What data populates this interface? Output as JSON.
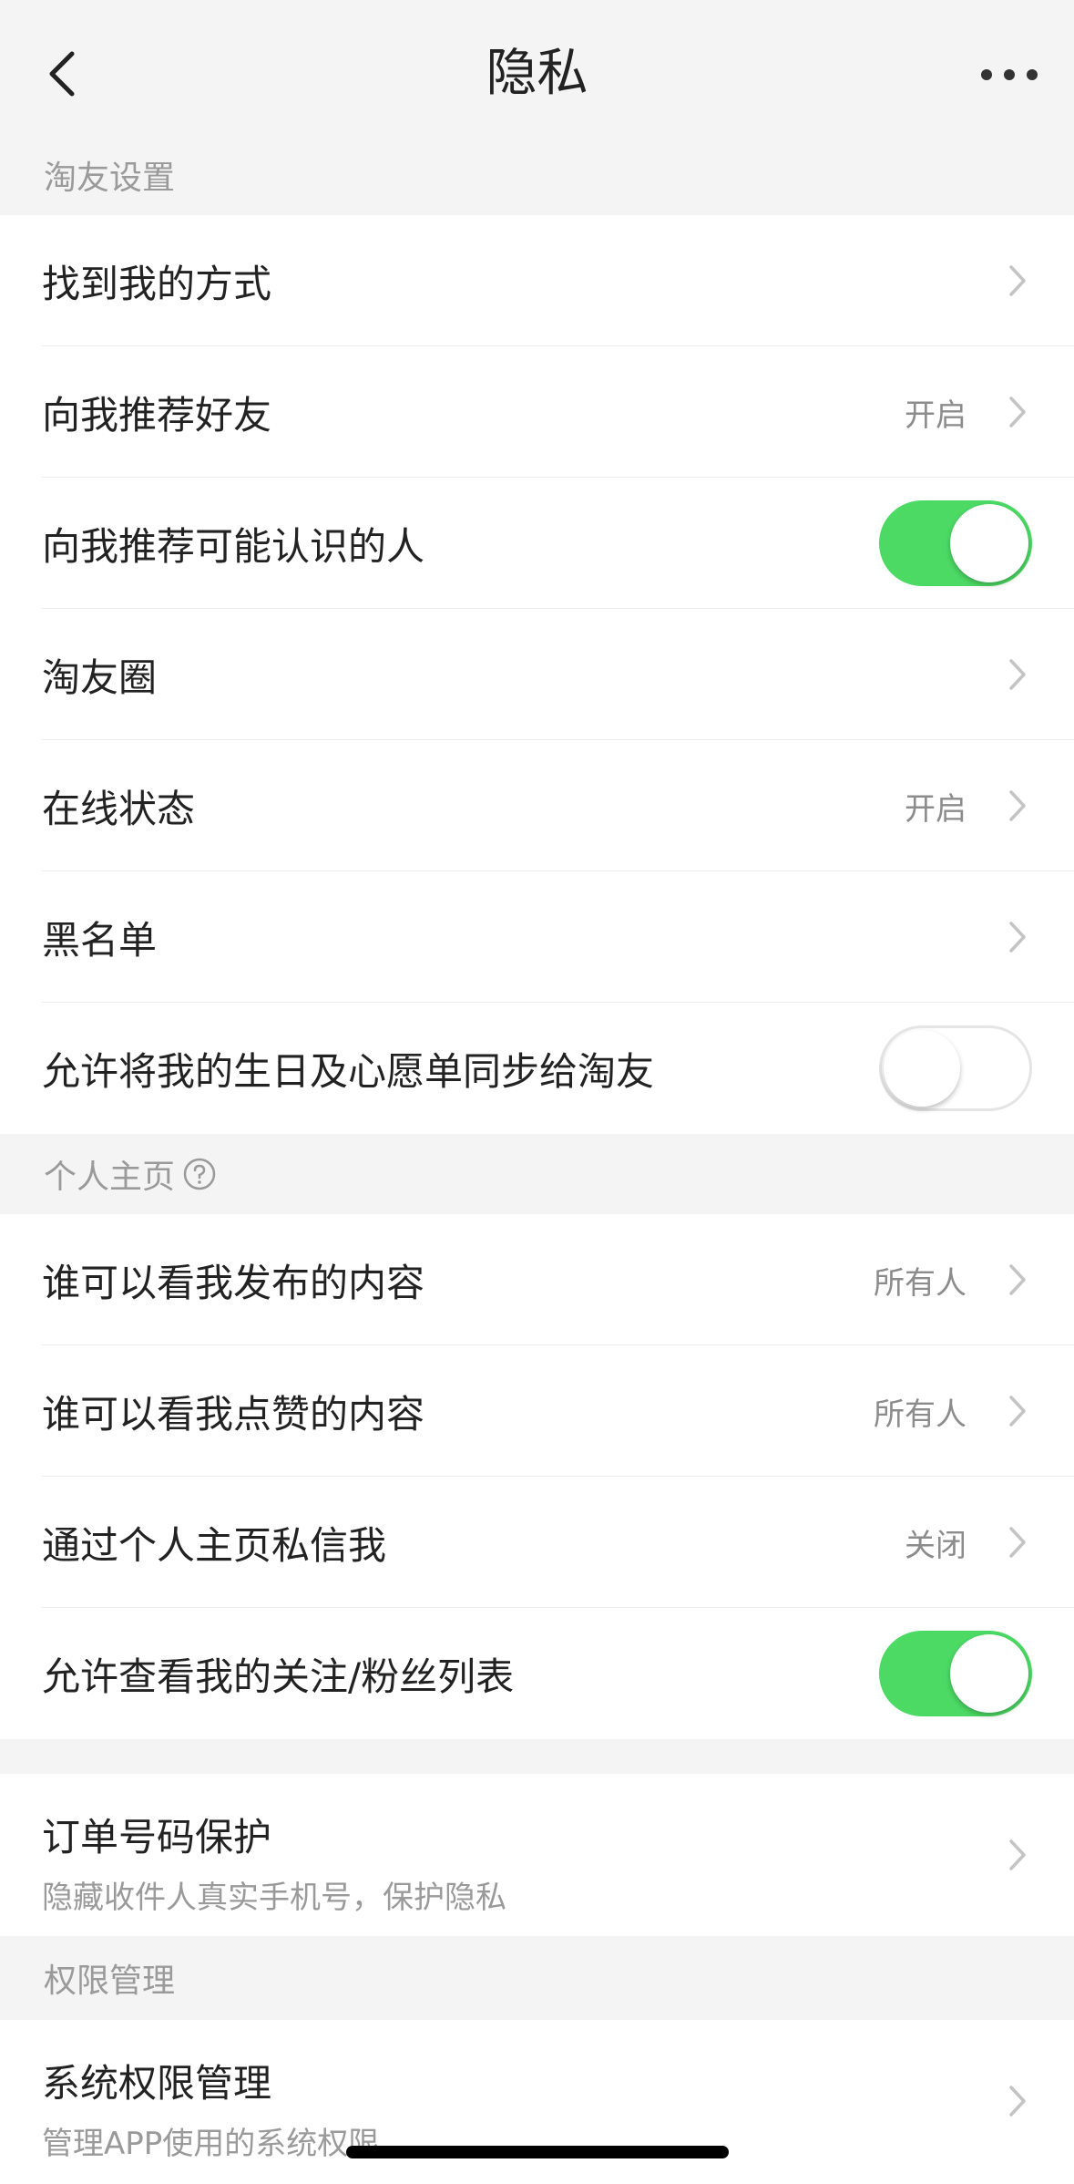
{
  "nav": {
    "title": "隐私",
    "back_icon": "chevron-left-icon",
    "more_icon": "more-dots-icon"
  },
  "sections": {
    "taoyou": {
      "header": "淘友设置",
      "rows": [
        {
          "label": "找到我的方式",
          "value": "",
          "control": "chevron"
        },
        {
          "label": "向我推荐好友",
          "value": "开启",
          "control": "chevron"
        },
        {
          "label": "向我推荐可能认识的人",
          "control": "toggle",
          "on": true
        },
        {
          "label": "淘友圈",
          "value": "",
          "control": "chevron"
        },
        {
          "label": "在线状态",
          "value": "开启",
          "control": "chevron"
        },
        {
          "label": "黑名单",
          "value": "",
          "control": "chevron"
        },
        {
          "label": "允许将我的生日及心愿单同步给淘友",
          "control": "toggle",
          "on": false
        }
      ]
    },
    "profile": {
      "header": "个人主页",
      "help_icon": "question-circle-icon",
      "rows": [
        {
          "label": "谁可以看我发布的内容",
          "value": "所有人",
          "control": "chevron"
        },
        {
          "label": "谁可以看我点赞的内容",
          "value": "所有人",
          "control": "chevron"
        },
        {
          "label": "通过个人主页私信我",
          "value": "关闭",
          "control": "chevron"
        },
        {
          "label": "允许查看我的关注/粉丝列表",
          "control": "toggle",
          "on": true
        }
      ]
    },
    "order": {
      "label": "订单号码保护",
      "sub": "隐藏收件人真实手机号，保护隐私"
    },
    "permission": {
      "header": "权限管理",
      "label": "系统权限管理",
      "sub": "管理APP使用的系统权限"
    }
  },
  "colors": {
    "toggle_on": "#4cd964",
    "background": "#f4f4f4"
  }
}
